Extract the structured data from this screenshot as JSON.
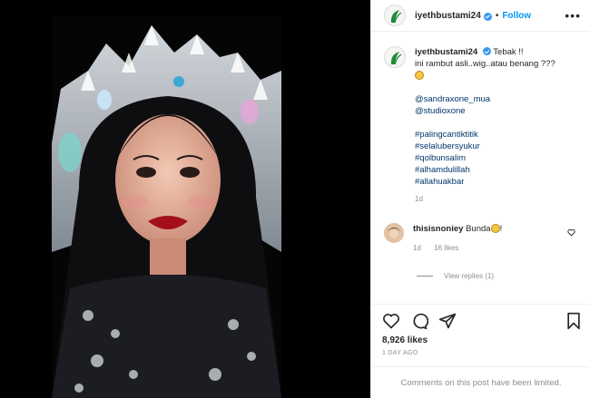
{
  "post": {
    "username": "iyethbustami24",
    "separator": "•",
    "follow_label": "Follow",
    "more_label": "•••",
    "photo_alt_icon": "portrait-photo"
  },
  "caption": {
    "username": "iyethbustami24",
    "line1": "Tebak !!",
    "line2": "ini rambut asli..wig..atau benang ???",
    "mentions": [
      "@sandraxone_mua",
      "@studioxone"
    ],
    "hashtags": [
      "#palingcantiktitik",
      "#selalubersyukur",
      "#qolbunsalim",
      "#alhamdulillah",
      "#allahuakbar"
    ],
    "time": "1d"
  },
  "comment": {
    "username": "thisisnoniey",
    "text": "Bunda",
    "suffix": "!",
    "time": "1d",
    "likes": "16 likes",
    "view_replies": "View replies (1)"
  },
  "actions": {
    "likes_count": "8,926 likes",
    "posted_ago": "1 DAY AGO"
  },
  "footer": {
    "notice": "Comments on this post have been limited."
  },
  "colors": {
    "accent": "#0095f6",
    "verified": "#3897f0",
    "link": "#00376b",
    "muted": "#8e8e8e"
  }
}
